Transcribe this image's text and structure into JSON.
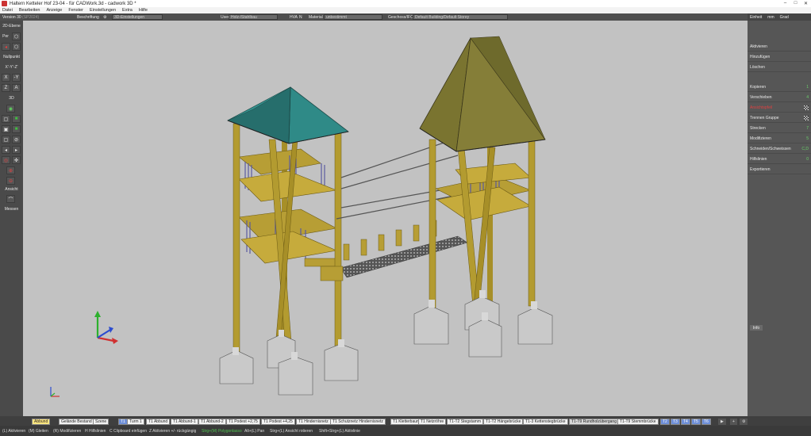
{
  "window": {
    "title": "Haltern Ketteler Hof 23-04 - für CADWork.3d - cadwork 3D *",
    "min": "–",
    "max": "□",
    "close": "✕"
  },
  "menu": [
    "Datei",
    "Bearbeiten",
    "Anzeige",
    "Fenster",
    "Einstellungen",
    "Extra",
    "Hilfe"
  ],
  "toolbar": {
    "version": "Version 30",
    "version_sp": "(SP2024)",
    "beschriftung": "Beschriftung",
    "einstellungen_placeholder": "3D-Einstellungen",
    "user": "User",
    "user_value": "Holz-/Stahlbau",
    "hva": "HVA",
    "hva_n": "N",
    "material": "Material",
    "material_value": "unbestimmt",
    "geschoss": "Geschoss/IFC",
    "geschoss_value": "Default Building/Default Storey"
  },
  "left_panel": {
    "ebene": "2D-Ebene",
    "per": "Per",
    "nullpunkt": "Nullpunkt",
    "xyz": "X'-Y'-Z'",
    "x": "X",
    "my": "-Y",
    "z": "Z",
    "a": "A",
    "three_d": "3D",
    "ansicht": "Ansicht",
    "messen": "Messen"
  },
  "right_panel": {
    "einheit": "Einheit",
    "mm": "mm",
    "grad": "Grad",
    "items": [
      {
        "label": "Aktivieren",
        "mark": ""
      },
      {
        "label": "Hinzufügen",
        "mark": ""
      },
      {
        "label": "Löschen",
        "mark": ""
      },
      {
        "label": "Kopieren",
        "mark": "1"
      },
      {
        "label": "Verschieben",
        "mark": "4"
      },
      {
        "label": "Ansichtspfeil",
        "mark": "",
        "red": true
      },
      {
        "label": "Trennen Gruppe",
        "mark": ""
      },
      {
        "label": "Strecken",
        "mark": "7"
      },
      {
        "label": "Modifizieren",
        "mark": "5"
      },
      {
        "label": "Schneiden/Schweissen",
        "mark": "C,D"
      },
      {
        "label": "Hilfslinien",
        "mark": "0"
      },
      {
        "label": "Exportieren",
        "mark": ""
      }
    ],
    "info": "Info"
  },
  "tabs": [
    "Abbund",
    "Gelände Bestand",
    "Szene",
    "T1",
    "Turm 1",
    "T1 Abbund",
    "T1 Abbund-1",
    "T1 Abbund-2",
    "T1 Podest +2,75",
    "T1 Podest +4,25",
    "T1 Hindernisnetz",
    "T1 Schutznetz Hindernisnetz",
    "T1 Kletterbaum",
    "T1 Netzröhre",
    "T1-T2 Stegstamm",
    "T1-T2 Hängebrücke",
    "T1-3 Kettenstegbrücke",
    "T1-T9 Rundholzübergang",
    "T1-T9 Stemmbrücke",
    "T2",
    "T3",
    "T4",
    "T5",
    "T6"
  ],
  "status": [
    {
      "text": "(L) Aktivieren"
    },
    {
      "text": "(M) Gleiten"
    },
    {
      "text": "(R) Modifizieren"
    },
    {
      "text": "H Hilfslinien"
    },
    {
      "text": "C Clipboard einfügen"
    },
    {
      "text": "Z Aktivieren +/- rückgängig"
    },
    {
      "text": "Strg+(M) Polygonlasso"
    },
    {
      "text": "Alt+(L) Pan"
    },
    {
      "text": "Strg+(L) Ansicht rotieren"
    },
    {
      "text": "Shift+Strg+(L) Aktivlinie"
    }
  ],
  "colors": {
    "roof_left": "#2d7a78",
    "roof_right": "#7d7630",
    "wood": "#b29a2e",
    "concrete": "#c8c8c8",
    "viewport_bg": "#c2c2c2",
    "active_tab": "#ffe680"
  }
}
